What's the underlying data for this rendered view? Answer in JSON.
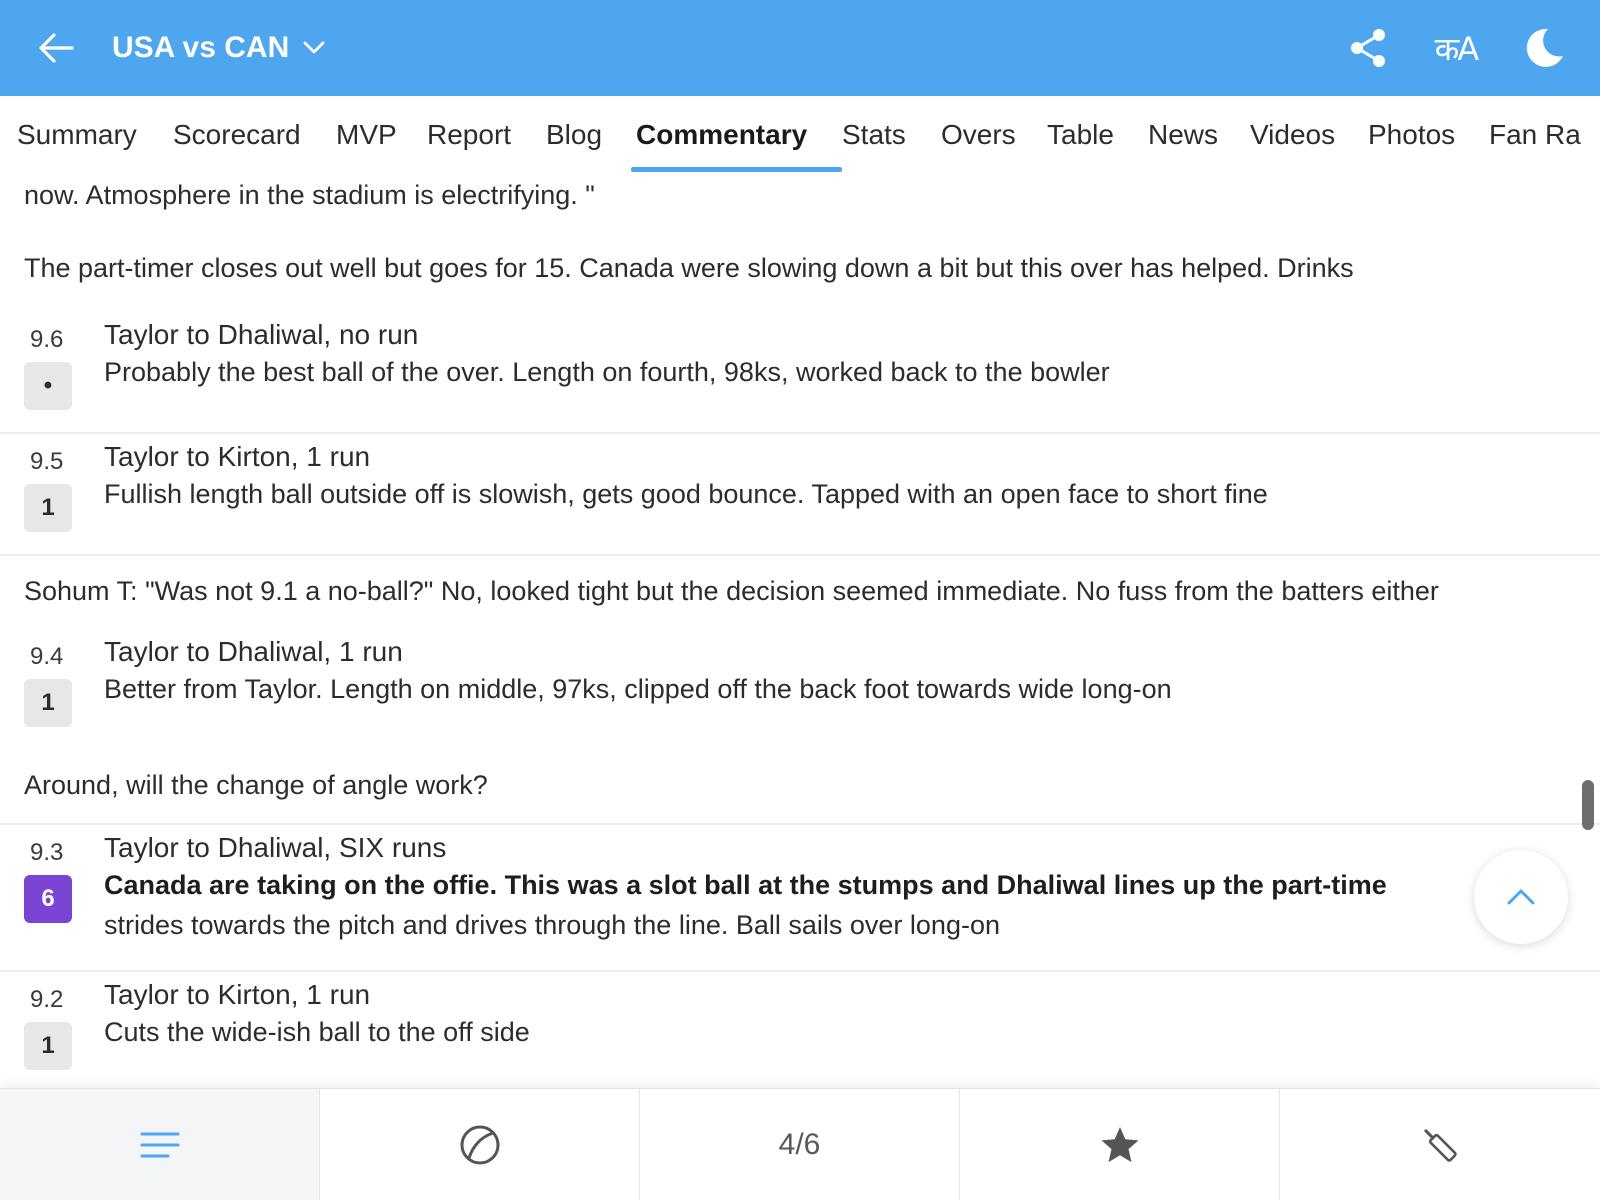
{
  "header": {
    "title": "USA vs CAN",
    "back_icon": "back-arrow-icon",
    "dropdown_icon": "chevron-down-icon",
    "actions": [
      "share-icon",
      "language-toggle-icon",
      "dark-mode-moon-icon"
    ],
    "lang_glyph": "कA",
    "color": "#4da6ee"
  },
  "tabs": [
    {
      "label": "Summary"
    },
    {
      "label": "Scorecard"
    },
    {
      "label": "MVP"
    },
    {
      "label": "Report"
    },
    {
      "label": "Blog"
    },
    {
      "label": "Commentary",
      "active": true
    },
    {
      "label": "Stats"
    },
    {
      "label": "Overs"
    },
    {
      "label": "Table"
    },
    {
      "label": "News"
    },
    {
      "label": "Videos"
    },
    {
      "label": "Photos"
    },
    {
      "label": "Fan Ra"
    }
  ],
  "commentary": {
    "note_top": "now. Atmosphere in the stadium is electrifying. \"",
    "note_drinks": "The part-timer closes out well but goes for 15. Canada were slowing down a bit but this over has helped. Drinks",
    "ball_9_6": {
      "over": "9.6",
      "badge": "•",
      "headline": "Taylor to Dhaliwal, no run",
      "desc": "Probably the best ball of the over. Length on fourth, 98ks, worked back to the bowler"
    },
    "ball_9_5": {
      "over": "9.5",
      "badge": "1",
      "headline": "Taylor to Kirton, 1 run",
      "desc": "Fullish length ball outside off is slowish, gets good bounce. Tapped with an open face to short fine"
    },
    "note_sohum": "Sohum T: \"Was not 9.1 a no-ball?\" No, looked tight but the decision seemed immediate. No fuss from the batters either",
    "ball_9_4": {
      "over": "9.4",
      "badge": "1",
      "headline": "Taylor to Dhaliwal, 1 run",
      "desc": "Better from Taylor. Length on middle, 97ks, clipped off the back foot towards wide long-on"
    },
    "note_around": "Around, will the change of angle work?",
    "ball_9_3": {
      "over": "9.3",
      "badge": "6",
      "headline": "Taylor to Dhaliwal, SIX runs",
      "desc_bold": "Canada are taking on the offie. This was a slot ball at the stumps and Dhaliwal lines up the part-time",
      "desc": "strides towards the pitch and drives through the line. Ball sails over long-on"
    },
    "ball_9_2": {
      "over": "9.2",
      "badge": "1",
      "headline": "Taylor to Kirton, 1 run",
      "desc": "Cuts the wide-ish ball to the off side"
    }
  },
  "colors": {
    "six_badge": "#7c44d4",
    "badge_bg": "#e6e7e8",
    "accent": "#4da6ee"
  },
  "bottom_bar": {
    "items": [
      "commentary-lines-icon",
      "ball-icon",
      "4/6",
      "star-icon",
      "bat-icon"
    ],
    "pager": "4/6"
  }
}
